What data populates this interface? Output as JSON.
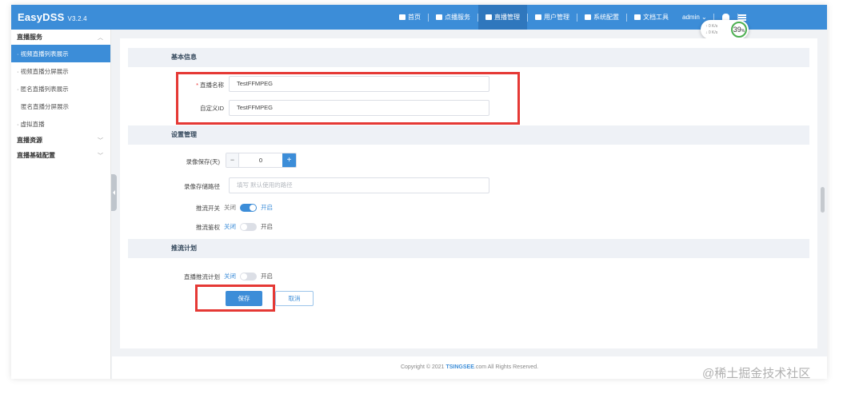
{
  "app": {
    "brand": "EasyDSS",
    "version": "V3.2.4"
  },
  "topnav": {
    "items": [
      {
        "label": "首页",
        "icon": "cloud-icon"
      },
      {
        "label": "点播服务",
        "icon": "video-icon"
      },
      {
        "label": "直播管理",
        "icon": "live-icon"
      },
      {
        "label": "用户管理",
        "icon": "user-icon"
      },
      {
        "label": "系统配置",
        "icon": "gear-icon"
      },
      {
        "label": "文档工具",
        "icon": "doc-icon"
      }
    ],
    "user": "admin",
    "network": {
      "up": "↑ 0  K/s",
      "down": "↓ 0  K/s",
      "percent": "39",
      "unit": "%"
    }
  },
  "sidebar": {
    "group1": "直播服务",
    "items": [
      "· 视频直播列表展示",
      "· 视频直播分屏展示",
      "· 匿名直播列表展示",
      "匿名直播分屏展示",
      "· 虚拟直播"
    ],
    "group2": "直播资源",
    "group3": "直播基础配置"
  },
  "form": {
    "section_basic": "基本信息",
    "name_label": "直播名称",
    "name_value": "TestFFMPEG",
    "custom_id_label": "自定义ID",
    "custom_id_value": "TestFFMPEG",
    "section_settings": "设置管理",
    "record_label": "录像保存(天)",
    "record_value": "0",
    "record_minus": "−",
    "record_plus": "+",
    "record_path_label": "录像存储路径",
    "record_path_placeholder": "填写 默认使用的路径",
    "push_switch_label": "推流开关",
    "push_switch_off": "关闭",
    "push_switch_on": "开启",
    "push_switch_state": true,
    "push_auth_label": "推流鉴权",
    "push_auth_off": "关闭",
    "push_auth_on": "开启",
    "push_auth_state": false,
    "section_plan": "推流计划",
    "plan_label": "直播推流计划",
    "plan_off": "关闭",
    "plan_on": "开启",
    "plan_state": false,
    "save_label": "保存",
    "cancel_label": "取消"
  },
  "footer": {
    "prefix": "Copyright © 2021 ",
    "brand": "TSINGSEE",
    "suffix": ".com All Rights Reserved."
  },
  "watermark": "@稀土掘金技术社区",
  "colors": {
    "primary": "#3c8dd8",
    "highlight_box": "#e53935"
  }
}
